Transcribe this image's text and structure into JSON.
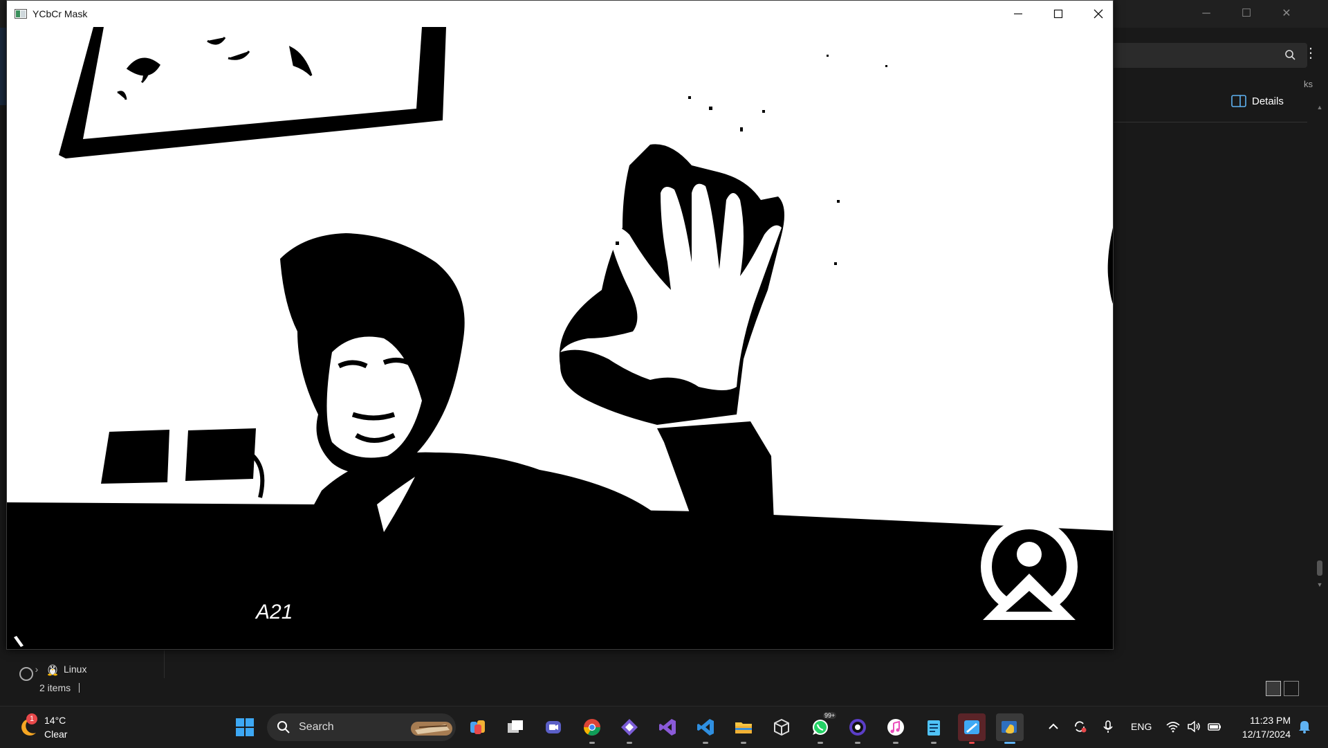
{
  "explorer": {
    "details_label": "Details",
    "partial_edge_text": "ks",
    "tree": {
      "item_label": "Linux"
    },
    "status": {
      "items_count": "2 items"
    }
  },
  "mask_window": {
    "title": "YCbCr Mask",
    "image_alt_text": "A21"
  },
  "taskbar": {
    "weather": {
      "temp": "14°C",
      "condition": "Clear",
      "badge": "1"
    },
    "search_label": "Search",
    "pinned_icons": [
      "start-icon",
      "copilot-icon",
      "task-view-icon",
      "meet-icon",
      "chrome-icon",
      "visual-studio-purple-icon",
      "visual-studio-icon",
      "vscode-icon",
      "file-explorer-icon",
      "virtualbox-icon",
      "whatsapp-icon",
      "obs-icon",
      "itunes-icon",
      "notepad-icon",
      "paint-icon",
      "python-icon"
    ],
    "whatsapp_badge": "99+",
    "tray": {
      "language": "ENG"
    },
    "clock": {
      "time": "11:23 PM",
      "date": "12/17/2024"
    }
  },
  "colors": {
    "taskbar_bg": "#1c1c1c",
    "accent": "#5fb2f2",
    "titlebar_bg": "#ffffff"
  }
}
